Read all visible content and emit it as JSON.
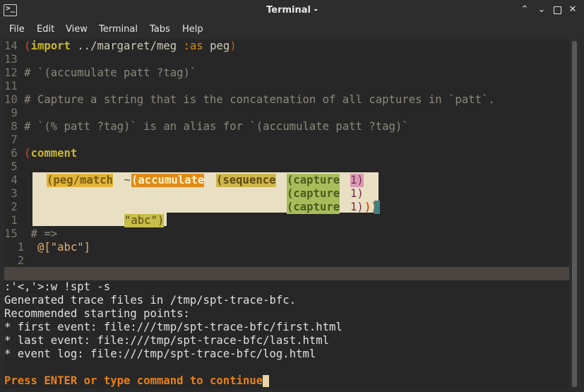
{
  "window": {
    "title": "Terminal -",
    "minimize_icon": "chevron-up-icon",
    "restore_icon": "chevron-down-icon",
    "maximize_icon": "square-icon",
    "close_icon": "close-icon"
  },
  "menu": [
    "File",
    "Edit",
    "View",
    "Terminal",
    "Tabs",
    "Help"
  ],
  "editor": {
    "l14": {
      "num": "14 ",
      "p1": "(",
      "kw": "import",
      "path": " ../margaret/meg ",
      "as": ":as",
      "name": " peg",
      "p2": ")"
    },
    "l13": {
      "num": "13"
    },
    "l12": {
      "num": "12 ",
      "text": "# `(accumulate patt ?tag)`"
    },
    "l11": {
      "num": "11"
    },
    "l10": {
      "num": "10 ",
      "text": "# Capture a string that is the concatenation of all captures in `patt`."
    },
    "l9": {
      "num": " 9"
    },
    "l8": {
      "num": " 8 ",
      "text": "# `(% patt ?tag)` is an alias for `(accumulate patt ?tag)`"
    },
    "l7": {
      "num": " 7"
    },
    "l6": {
      "num": " 6 ",
      "p1": "(",
      "kw": "comment"
    },
    "l5": {
      "num": " 5"
    },
    "l4": {
      "num": " 4",
      "peg_match": "(peg/match",
      "tilde": " ~",
      "acc": "(accumulate",
      "seq": "(sequence",
      "cap": "(capture",
      "one": "1)"
    },
    "l3": {
      "num": " 3",
      "cap": "(capture",
      "one": "1)"
    },
    "l2": {
      "num": " 2",
      "cap": "(capture",
      "one": "1)",
      "close": "))"
    },
    "l1": {
      "num": " 1",
      "abc": "\"abc\")"
    },
    "l15": {
      "num": "15",
      "text": "  # =>"
    },
    "r1": {
      "num": "  1",
      "text": "  @[\"abc\"]"
    },
    "r2": {
      "num": "  2"
    }
  },
  "output": [
    ":'<,'>:w !spt -s",
    "Generated trace files in /tmp/spt-trace-bfc.",
    "Recommended starting points:",
    "* first event: file:///tmp/spt-trace-bfc/first.html",
    "* last event: file:///tmp/spt-trace-bfc/last.html",
    "* event log: file:///tmp/spt-trace-bfc/log.html"
  ],
  "prompt": "Press ENTER or type command to continue"
}
